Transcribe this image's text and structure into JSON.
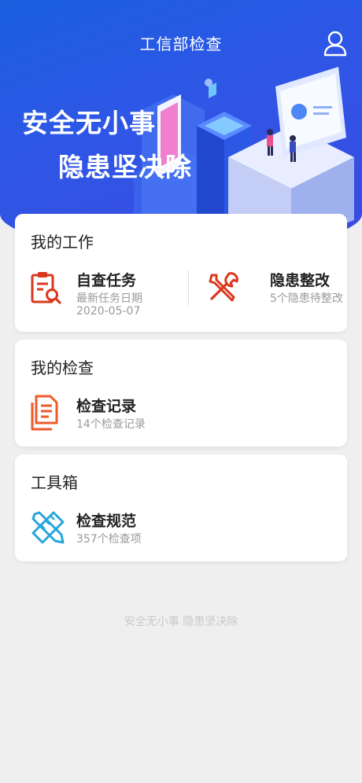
{
  "header": {
    "title": "工信部检查",
    "user_icon": "user-icon"
  },
  "banner": {
    "slogan_line1": "安全无小事",
    "slogan_line2": "隐患坚决除"
  },
  "my_work": {
    "title": "我的工作",
    "self_check": {
      "name": "自查任务",
      "sub_label": "最新任务日期",
      "sub_value": "2020-05-07",
      "icon": "clipboard-search-icon"
    },
    "rectify": {
      "name": "隐患整改",
      "sub": "5个隐患待整改",
      "icon": "tools-icon"
    }
  },
  "my_check": {
    "title": "我的检查",
    "records": {
      "name": "检查记录",
      "sub": "14个检查记录",
      "icon": "documents-icon"
    }
  },
  "toolbox": {
    "title": "工具箱",
    "standards": {
      "name": "检查规范",
      "sub": "357个检查项",
      "icon": "ruler-pencil-icon"
    }
  },
  "footer": {
    "text": "安全无小事 隐患坚决除"
  },
  "colors": {
    "primary_blue": "#2355e4",
    "accent_red": "#d9381e",
    "accent_orange": "#ee5a2b",
    "accent_cyan": "#26a6dc"
  }
}
